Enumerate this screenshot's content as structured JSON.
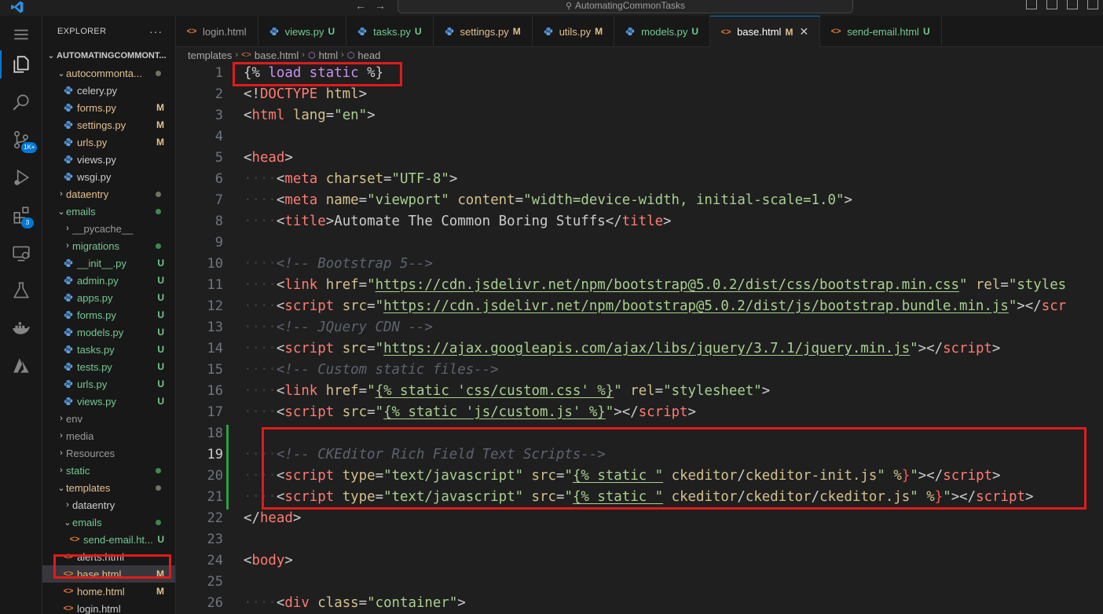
{
  "titlebar": {
    "search": "AutomatingCommonTasks",
    "back": "←",
    "forward": "→"
  },
  "activity": {
    "source_control_badge": "1K+",
    "extensions_badge": "3"
  },
  "explorer": {
    "title": "EXPLORER",
    "more": "···",
    "root": "AUTOMATINGCOMMONT...",
    "tree": [
      {
        "label": "autocommonta...",
        "chev": "v",
        "indent": 0,
        "icon": "folder",
        "color": "mod",
        "status": "",
        "dot": "grey"
      },
      {
        "label": "celery.py",
        "chev": "",
        "indent": 1,
        "icon": "python",
        "color": "def",
        "status": "",
        "dot": ""
      },
      {
        "label": "forms.py",
        "chev": "",
        "indent": 1,
        "icon": "python",
        "color": "mod",
        "status": "M",
        "dot": ""
      },
      {
        "label": "settings.py",
        "chev": "",
        "indent": 1,
        "icon": "python",
        "color": "mod",
        "status": "M",
        "dot": ""
      },
      {
        "label": "urls.py",
        "chev": "",
        "indent": 1,
        "icon": "python",
        "color": "mod",
        "status": "M",
        "dot": ""
      },
      {
        "label": "views.py",
        "chev": "",
        "indent": 1,
        "icon": "python",
        "color": "def",
        "status": "",
        "dot": ""
      },
      {
        "label": "wsgi.py",
        "chev": "",
        "indent": 1,
        "icon": "python",
        "color": "def",
        "status": "",
        "dot": ""
      },
      {
        "label": "dataentry",
        "chev": ">",
        "indent": 0,
        "icon": "folder",
        "color": "mod",
        "status": "",
        "dot": "grey"
      },
      {
        "label": "emails",
        "chev": "v",
        "indent": 0,
        "icon": "folder",
        "color": "unt",
        "status": "",
        "dot": "green"
      },
      {
        "label": "__pycache__",
        "chev": ">",
        "indent": 1,
        "icon": "folder",
        "color": "dim",
        "status": "",
        "dot": ""
      },
      {
        "label": "migrations",
        "chev": ">",
        "indent": 1,
        "icon": "folder",
        "color": "unt",
        "status": "",
        "dot": "green"
      },
      {
        "label": "__init__.py",
        "chev": "",
        "indent": 1,
        "icon": "python",
        "color": "unt",
        "status": "U",
        "dot": ""
      },
      {
        "label": "admin.py",
        "chev": "",
        "indent": 1,
        "icon": "python",
        "color": "unt",
        "status": "U",
        "dot": ""
      },
      {
        "label": "apps.py",
        "chev": "",
        "indent": 1,
        "icon": "python",
        "color": "unt",
        "status": "U",
        "dot": ""
      },
      {
        "label": "forms.py",
        "chev": "",
        "indent": 1,
        "icon": "python",
        "color": "unt",
        "status": "U",
        "dot": ""
      },
      {
        "label": "models.py",
        "chev": "",
        "indent": 1,
        "icon": "python",
        "color": "unt",
        "status": "U",
        "dot": ""
      },
      {
        "label": "tasks.py",
        "chev": "",
        "indent": 1,
        "icon": "python",
        "color": "unt",
        "status": "U",
        "dot": ""
      },
      {
        "label": "tests.py",
        "chev": "",
        "indent": 1,
        "icon": "python",
        "color": "unt",
        "status": "U",
        "dot": ""
      },
      {
        "label": "urls.py",
        "chev": "",
        "indent": 1,
        "icon": "python",
        "color": "unt",
        "status": "U",
        "dot": ""
      },
      {
        "label": "views.py",
        "chev": "",
        "indent": 1,
        "icon": "python",
        "color": "unt",
        "status": "U",
        "dot": ""
      },
      {
        "label": "env",
        "chev": ">",
        "indent": 0,
        "icon": "folder",
        "color": "dim",
        "status": "",
        "dot": ""
      },
      {
        "label": "media",
        "chev": ">",
        "indent": 0,
        "icon": "folder",
        "color": "dim",
        "status": "",
        "dot": ""
      },
      {
        "label": "Resources",
        "chev": ">",
        "indent": 0,
        "icon": "folder",
        "color": "dim",
        "status": "",
        "dot": ""
      },
      {
        "label": "static",
        "chev": ">",
        "indent": 0,
        "icon": "folder",
        "color": "unt",
        "status": "",
        "dot": "green"
      },
      {
        "label": "templates",
        "chev": "v",
        "indent": 0,
        "icon": "folder",
        "color": "mod",
        "status": "",
        "dot": "grey"
      },
      {
        "label": "dataentry",
        "chev": ">",
        "indent": 1,
        "icon": "folder",
        "color": "def",
        "status": "",
        "dot": ""
      },
      {
        "label": "emails",
        "chev": "v",
        "indent": 1,
        "icon": "folder",
        "color": "unt",
        "status": "",
        "dot": "green"
      },
      {
        "label": "send-email.ht...",
        "chev": "",
        "indent": 2,
        "icon": "html",
        "color": "unt",
        "status": "U",
        "dot": ""
      },
      {
        "label": "alerts.html",
        "chev": "",
        "indent": 1,
        "icon": "html",
        "color": "def",
        "status": "",
        "dot": ""
      },
      {
        "label": "base.html",
        "chev": "",
        "indent": 1,
        "icon": "html",
        "color": "mod",
        "status": "M",
        "dot": "",
        "selected": true
      },
      {
        "label": "home.html",
        "chev": "",
        "indent": 1,
        "icon": "html",
        "color": "mod",
        "status": "M",
        "dot": ""
      },
      {
        "label": "login.html",
        "chev": "",
        "indent": 1,
        "icon": "html",
        "color": "def",
        "status": "",
        "dot": ""
      }
    ]
  },
  "tabs": [
    {
      "label": "login.html",
      "icon": "html",
      "status": "",
      "color": "def",
      "active": false
    },
    {
      "label": "views.py",
      "icon": "python",
      "status": "U",
      "color": "unt",
      "active": false
    },
    {
      "label": "tasks.py",
      "icon": "python",
      "status": "U",
      "color": "unt",
      "active": false
    },
    {
      "label": "settings.py",
      "icon": "python",
      "status": "M",
      "color": "mod",
      "active": false
    },
    {
      "label": "utils.py",
      "icon": "python",
      "status": "M",
      "color": "mod",
      "active": false
    },
    {
      "label": "models.py",
      "icon": "python",
      "status": "U",
      "color": "unt",
      "active": false
    },
    {
      "label": "base.html",
      "icon": "html",
      "status": "M",
      "color": "mod",
      "active": true
    },
    {
      "label": "send-email.html",
      "icon": "html",
      "status": "U",
      "color": "unt",
      "active": false
    }
  ],
  "tab_close": "✕",
  "breadcrumb": [
    "templates",
    "base.html",
    "html",
    "head"
  ],
  "editor": {
    "current_line": 19,
    "lines": [
      {
        "n": "1",
        "html": "<span class='t-dj'>{% </span><span class='t-kw'>load</span><span class='t-dj'> </span><span class='t-kw'>static</span><span class='t-dj'> %}</span>"
      },
      {
        "n": "2",
        "html": "<span class='t-br'>&lt;!</span><span class='t-tag'>DOCTYPE</span><span class='t-br'> </span><span class='t-attr'>html</span><span class='t-br'>&gt;</span>"
      },
      {
        "n": "3",
        "html": "<span class='t-br'>&lt;</span><span class='t-tag'>html</span> <span class='t-attr'>lang</span><span class='t-br'>=</span><span class='t-str'>\"en\"</span><span class='t-br'>&gt;</span>"
      },
      {
        "n": "4",
        "html": ""
      },
      {
        "n": "5",
        "html": "<span class='t-br'>&lt;</span><span class='t-tag'>head</span><span class='t-br'>&gt;</span>"
      },
      {
        "n": "6",
        "html": "<span class='ws'>····</span><span class='t-br'>&lt;</span><span class='t-tag'>meta</span> <span class='t-attr'>charset</span><span class='t-br'>=</span><span class='t-str'>\"UTF-8\"</span><span class='t-br'>&gt;</span>"
      },
      {
        "n": "7",
        "html": "<span class='ws'>····</span><span class='t-br'>&lt;</span><span class='t-tag'>meta</span> <span class='t-attr'>name</span><span class='t-br'>=</span><span class='t-str'>\"viewport\"</span> <span class='t-attr'>content</span><span class='t-br'>=</span><span class='t-str'>\"width=device-width, initial-scale=1.0\"</span><span class='t-br'>&gt;</span>"
      },
      {
        "n": "8",
        "html": "<span class='ws'>····</span><span class='t-br'>&lt;</span><span class='t-tag'>title</span><span class='t-br'>&gt;</span>Automate The Common Boring Stuffs<span class='t-br'>&lt;/</span><span class='t-tag'>title</span><span class='t-br'>&gt;</span>"
      },
      {
        "n": "9",
        "html": ""
      },
      {
        "n": "10",
        "html": "<span class='ws'>····</span><span class='t-cm'>&lt;!-- Bootstrap 5--&gt;</span>"
      },
      {
        "n": "11",
        "html": "<span class='ws'>····</span><span class='t-br'>&lt;</span><span class='t-tag'>link</span> <span class='t-attr'>href</span><span class='t-br'>=</span><span class='t-str'>\"<span class='u'>https://cdn.jsdelivr.net/npm/bootstrap@5.0.2/dist/css/bootstrap.min.css</span>\"</span> <span class='t-attr'>rel</span><span class='t-br'>=</span><span class='t-str'>\"styles</span>"
      },
      {
        "n": "12",
        "html": "<span class='ws'>····</span><span class='t-br'>&lt;</span><span class='t-tag'>script</span> <span class='t-attr'>src</span><span class='t-br'>=</span><span class='t-str'>\"<span class='u'>https://cdn.jsdelivr.net/npm/bootstrap@5.0.2/dist/js/bootstrap.bundle.min.js</span>\"</span><span class='t-br'>&gt;&lt;/</span><span class='t-tag'>scr</span>"
      },
      {
        "n": "13",
        "html": "<span class='ws'>····</span><span class='t-cm'>&lt;!-- JQuery CDN --&gt;</span>"
      },
      {
        "n": "14",
        "html": "<span class='ws'>····</span><span class='t-br'>&lt;</span><span class='t-tag'>script</span> <span class='t-attr'>src</span><span class='t-br'>=</span><span class='t-str'>\"<span class='u'>https://ajax.googleapis.com/ajax/libs/jquery/3.7.1/jquery.min.js</span>\"</span><span class='t-br'>&gt;&lt;/</span><span class='t-tag'>script</span><span class='t-br'>&gt;</span>"
      },
      {
        "n": "15",
        "html": "<span class='ws'>····</span><span class='t-cm'>&lt;!-- Custom static files--&gt;</span>"
      },
      {
        "n": "16",
        "html": "<span class='ws'>····</span><span class='t-br'>&lt;</span><span class='t-tag'>link</span> <span class='t-attr'>href</span><span class='t-br'>=</span><span class='t-str'>\"<span class='u'>{% static 'css/custom.css' %}</span>\"</span> <span class='t-attr'>rel</span><span class='t-br'>=</span><span class='t-str'>\"stylesheet\"</span><span class='t-br'>&gt;</span>"
      },
      {
        "n": "17",
        "html": "<span class='ws'>····</span><span class='t-br'>&lt;</span><span class='t-tag'>script</span> <span class='t-attr'>src</span><span class='t-br'>=</span><span class='t-str'>\"<span class='u'>{% static 'js/custom.js' %}</span>\"</span><span class='t-br'>&gt;&lt;/</span><span class='t-tag'>script</span><span class='t-br'>&gt;</span>"
      },
      {
        "n": "18",
        "html": ""
      },
      {
        "n": "19",
        "html": "<span class='ws'>····</span><span class='t-cm'>&lt;!-- CKEditor Rich Field Text Scripts--&gt;</span>"
      },
      {
        "n": "20",
        "html": "<span class='ws'>····</span><span class='t-br'>&lt;</span><span class='t-tag'>script</span> <span class='t-attr'>type</span><span class='t-br'>=</span><span class='t-str'>\"text/javascript\"</span> <span class='t-attr'>src</span><span class='t-br'>=</span><span class='t-str'>\"<span class='u'>{% static \"</span></span> <span class='t-attr'>ckeditor</span><span class='t-br'>/</span><span class='t-attr'>ckeditor-init.js</span><span class='t-str'>\"</span> <span class='t-attr'>%</span><span class='t-red'>}</span><span class='t-str'>\"</span><span class='t-br'>&gt;&lt;/</span><span class='t-tag'>script</span><span class='t-br'>&gt;</span>"
      },
      {
        "n": "21",
        "html": "<span class='ws'>····</span><span class='t-br'>&lt;</span><span class='t-tag'>script</span> <span class='t-attr'>type</span><span class='t-br'>=</span><span class='t-str'>\"text/javascript\"</span> <span class='t-attr'>src</span><span class='t-br'>=</span><span class='t-str'>\"<span class='u'>{% static \"</span></span> <span class='t-attr'>ckeditor</span><span class='t-br'>/</span><span class='t-attr'>ckeditor</span><span class='t-br'>/</span><span class='t-attr'>ckeditor.js</span><span class='t-str'>\"</span> <span class='t-attr'>%</span><span class='t-red'>}</span><span class='t-str'>\"</span><span class='t-br'>&gt;&lt;/</span><span class='t-tag'>script</span><span class='t-br'>&gt;</span>"
      },
      {
        "n": "22",
        "html": "<span class='t-br'>&lt;/</span><span class='t-tag'>head</span><span class='t-br'>&gt;</span>"
      },
      {
        "n": "23",
        "html": ""
      },
      {
        "n": "24",
        "html": "<span class='t-br'>&lt;</span><span class='t-tag'>body</span><span class='t-br'>&gt;</span>"
      },
      {
        "n": "25",
        "html": ""
      },
      {
        "n": "26",
        "html": "<span class='ws'>····</span><span class='t-br'>&lt;</span><span class='t-tag'>div</span> <span class='t-attr'>class</span><span class='t-br'>=</span><span class='t-str'>\"container\"</span><span class='t-br'>&gt;</span>"
      }
    ]
  },
  "colors": {
    "accent": "#0078d4",
    "modified": "#e2c08d",
    "untracked": "#73c991",
    "highlight_box": "#e01b1b"
  }
}
